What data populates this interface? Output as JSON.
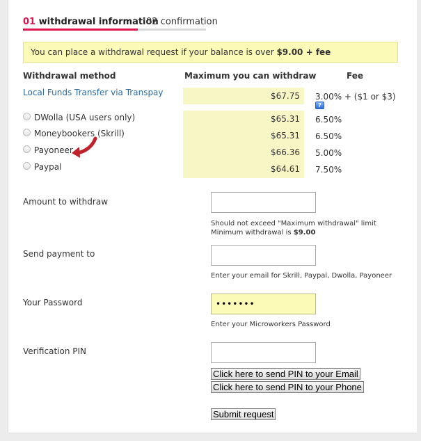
{
  "tabs": {
    "step1_num": "01",
    "step1_label": "withdrawal information",
    "step2_num": "02",
    "step2_label": "confirmation"
  },
  "notice": {
    "text": "You can place a withdrawal request if your balance is over ",
    "amount": "$9.00 + fee"
  },
  "table": {
    "headers": {
      "method": "Withdrawal method",
      "max": "Maximum you can withdraw",
      "fee": "Fee"
    },
    "transpay": {
      "label": "Local Funds Transfer via Transpay",
      "max": "$67.75",
      "fee": "3.00% + ($1 or $3)",
      "help": "?"
    },
    "methods": [
      {
        "label": "DWolla (USA users only)",
        "max": "$65.31",
        "fee": "6.50%"
      },
      {
        "label": "Moneybookers (Skrill)",
        "max": "$65.31",
        "fee": "6.50%"
      },
      {
        "label": "Payoneer",
        "max": "$66.36",
        "fee": "5.00%"
      },
      {
        "label": "Paypal",
        "max": "$64.61",
        "fee": "7.50%"
      }
    ]
  },
  "form": {
    "amount": {
      "label": "Amount to withdraw",
      "value": "",
      "hint1": "Should not exceed \"Maximum withdrawal\" limit",
      "hint2_prefix": "Minimum withdrawal is ",
      "hint2_amount": "$9.00"
    },
    "send_to": {
      "label": "Send payment to",
      "value": "",
      "hint": "Enter your email for Skrill, Paypal, Dwolla, Payoneer"
    },
    "password": {
      "label": "Your Password",
      "value": "•••••••",
      "hint": "Enter your Microworkers Password"
    },
    "pin": {
      "label": "Verification PIN",
      "value": "",
      "btn_email": "Click here to send PIN to your Email",
      "btn_phone": "Click here to send PIN to your Phone"
    },
    "submit": "Submit request"
  },
  "colors": {
    "accent": "#e0114f",
    "highlight": "#fbfbb7",
    "link": "#2a6aa0",
    "arrow": "#c0222b"
  }
}
